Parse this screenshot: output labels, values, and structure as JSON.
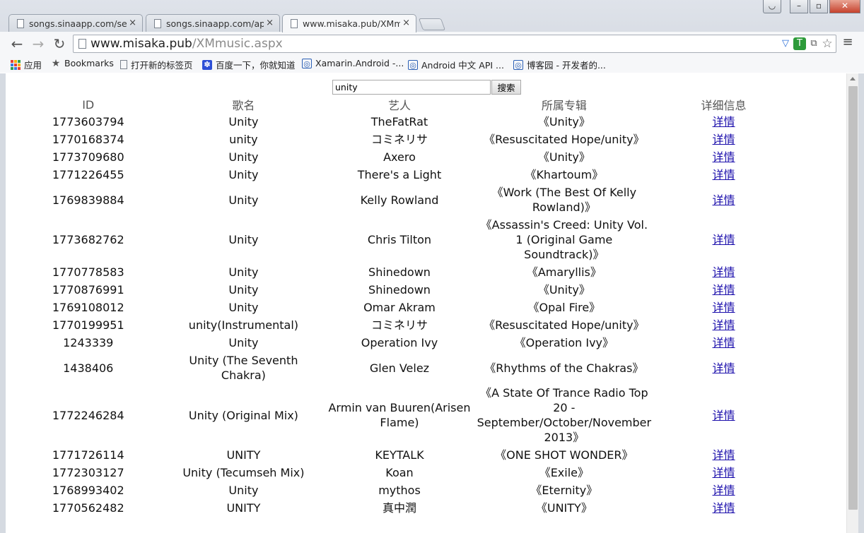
{
  "browser": {
    "tabs": [
      {
        "title": "songs.sinaapp.com/sear",
        "active": false
      },
      {
        "title": "songs.sinaapp.com/apiv",
        "active": false
      },
      {
        "title": "www.misaka.pub/XMmu",
        "active": true
      }
    ],
    "tab_close": "×",
    "window_buttons": {
      "user": "◡",
      "minimize": "–",
      "restore": "▫",
      "close": "✕"
    },
    "nav": {
      "back": "←",
      "forward": "→",
      "reload": "↻"
    },
    "url": {
      "host": "www.misaka.pub",
      "path": "/XMmusic.aspx"
    },
    "menu": "≡",
    "bookmarks": [
      {
        "label": "应用",
        "icon": "apps-grid-icon"
      },
      {
        "label": "Bookmarks",
        "icon": "star-icon"
      },
      {
        "label": "打开新的标签页",
        "icon": "page-icon"
      },
      {
        "label": "百度一下，你就知道",
        "icon": "baidu-paw-icon"
      },
      {
        "label": "Xamarin.Android -...",
        "icon": "globe-icon"
      },
      {
        "label": "Android 中文 API ...",
        "icon": "globe-icon"
      },
      {
        "label": "博客园 - 开发者的...",
        "icon": "globe-icon"
      }
    ]
  },
  "search": {
    "value": "unity",
    "button": "搜索"
  },
  "table": {
    "headers": [
      "ID",
      "歌名",
      "艺人",
      "所属专辑",
      "详细信息"
    ],
    "detail_label": "详情",
    "rows": [
      {
        "id": "1773603794",
        "song": "Unity",
        "artist": "TheFatRat",
        "album": "《Unity》"
      },
      {
        "id": "1770168374",
        "song": "unity",
        "artist": "コミネリサ",
        "album": "《Resuscitated Hope/unity》"
      },
      {
        "id": "1773709680",
        "song": "Unity",
        "artist": "Axero",
        "album": "《Unity》"
      },
      {
        "id": "1771226455",
        "song": "Unity",
        "artist": "There's a Light",
        "album": "《Khartoum》"
      },
      {
        "id": "1769839884",
        "song": "Unity",
        "artist": "Kelly Rowland",
        "album": "《Work (The Best Of Kelly Rowland)》"
      },
      {
        "id": "1773682762",
        "song": "Unity",
        "artist": "Chris Tilton",
        "album": "《Assassin's Creed: Unity Vol. 1 (Original Game Soundtrack)》"
      },
      {
        "id": "1770778583",
        "song": "Unity",
        "artist": "Shinedown",
        "album": "《Amaryllis》"
      },
      {
        "id": "1770876991",
        "song": "Unity",
        "artist": "Shinedown",
        "album": "《Unity》"
      },
      {
        "id": "1769108012",
        "song": "Unity",
        "artist": "Omar Akram",
        "album": "《Opal Fire》"
      },
      {
        "id": "1770199951",
        "song": "unity(Instrumental)",
        "artist": "コミネリサ",
        "album": "《Resuscitated Hope/unity》"
      },
      {
        "id": "1243339",
        "song": "Unity",
        "artist": "Operation Ivy",
        "album": "《Operation Ivy》"
      },
      {
        "id": "1438406",
        "song": "Unity (The Seventh Chakra)",
        "artist": "Glen Velez",
        "album": "《Rhythms of the Chakras》"
      },
      {
        "id": "1772246284",
        "song": "Unity (Original Mix)",
        "artist": "Armin van Buuren(Arisen Flame)",
        "album": "《A State Of Trance Radio Top 20 - September/October/November 2013》"
      },
      {
        "id": "1771726114",
        "song": "UNITY",
        "artist": "KEYTALK",
        "album": "《ONE SHOT WONDER》"
      },
      {
        "id": "1772303127",
        "song": "Unity (Tecumseh Mix)",
        "artist": "Koan",
        "album": "《Exile》"
      },
      {
        "id": "1768993402",
        "song": "Unity",
        "artist": "mythos",
        "album": "《Eternity》"
      },
      {
        "id": "1770562482",
        "song": "UNITY",
        "artist": "真中潤",
        "album": "《UNITY》"
      }
    ]
  }
}
